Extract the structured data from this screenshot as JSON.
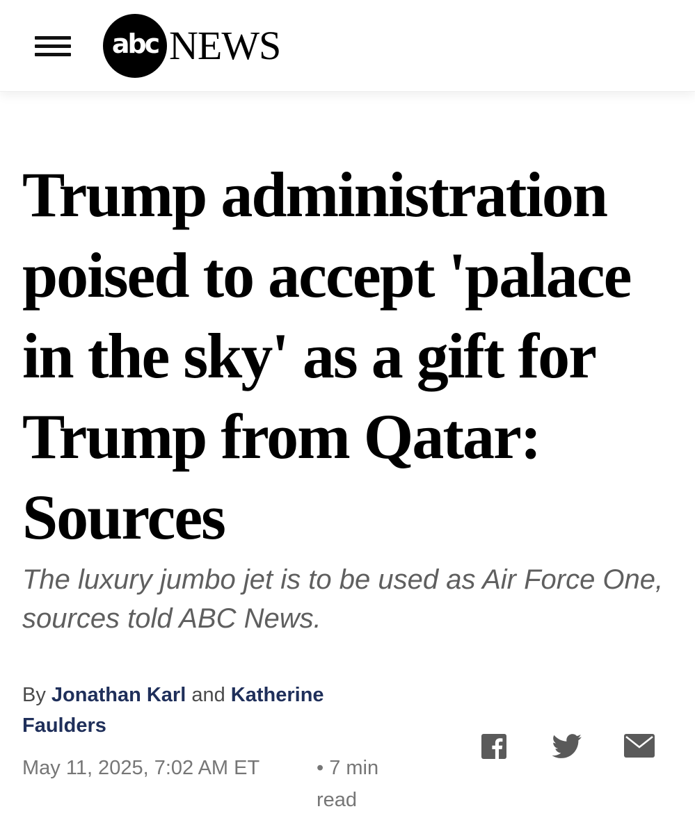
{
  "header": {
    "menu_icon": "hamburger-menu-icon",
    "logo": {
      "abc": "abc",
      "news": "NEWS"
    }
  },
  "article": {
    "headline": "Trump administration poised to accept 'palace in the sky' as a gift for Trump from Qatar: Sources",
    "dek": "The luxury jumbo jet is to be used as Air Force One, sources told ABC News.",
    "byline": {
      "prefix": "By",
      "author1": "Jonathan Karl",
      "conjunction": "and",
      "author2": "Katherine Faulders"
    },
    "date": "May 11, 2025, 7:02 AM ET",
    "read_time": "• 7 min read"
  },
  "share": {
    "icons": [
      "facebook-icon",
      "twitter-icon",
      "email-icon"
    ]
  },
  "colors": {
    "author_link": "#1f2f5a",
    "dek": "#5f5f5f",
    "meta": "#767676"
  }
}
